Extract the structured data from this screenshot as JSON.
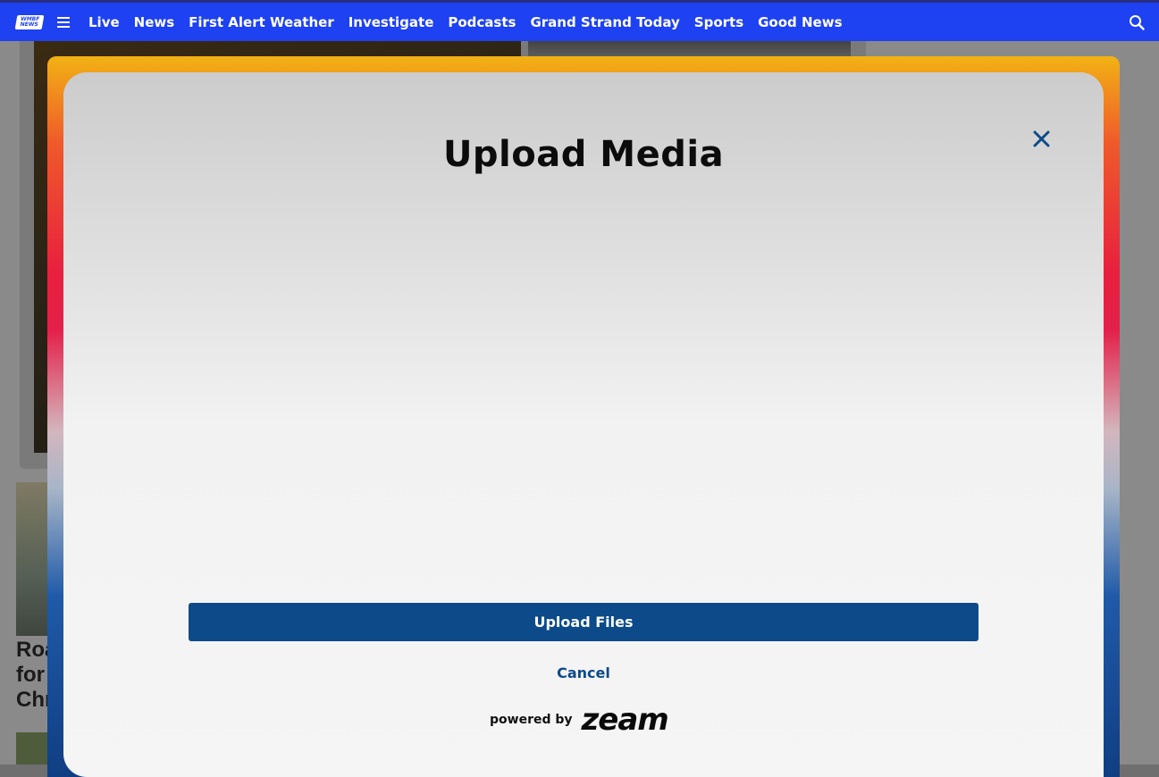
{
  "nav": {
    "logo_text": "WMBF NEWS",
    "links": [
      "Live",
      "News",
      "First Alert Weather",
      "Investigate",
      "Podcasts",
      "Grand Strand Today",
      "Sports",
      "Good News"
    ]
  },
  "background": {
    "headline": "Roa\nfor\nChr"
  },
  "modal": {
    "title": "Upload Media",
    "upload_label": "Upload Files",
    "cancel_label": "Cancel",
    "powered_by": "powered by",
    "brand": "zeam"
  },
  "colors": {
    "nav_bg": "#1e41f2",
    "primary": "#0c4a8a"
  },
  "icons": {
    "menu": "hamburger-icon",
    "search": "search-icon",
    "close": "close-icon"
  }
}
